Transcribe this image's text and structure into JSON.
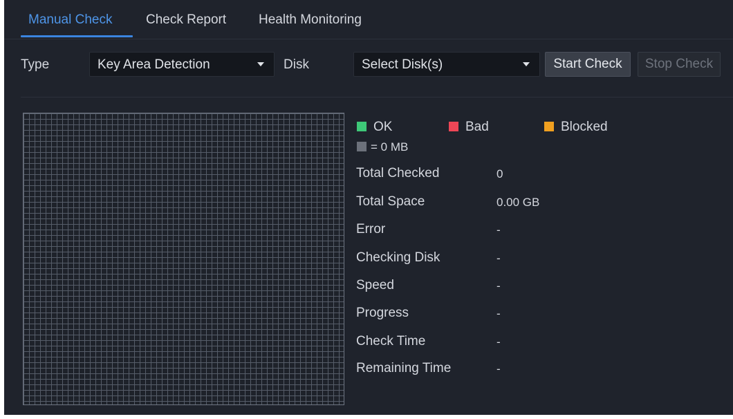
{
  "tabs": [
    {
      "label": "Manual Check",
      "active": true
    },
    {
      "label": "Check Report",
      "active": false
    },
    {
      "label": "Health Monitoring",
      "active": false
    }
  ],
  "toolbar": {
    "type_label": "Type",
    "type_value": "Key Area Detection",
    "disk_label": "Disk",
    "disk_value": "Select Disk(s)",
    "start_label": "Start Check",
    "stop_label": "Stop Check"
  },
  "legend": {
    "ok": {
      "label": "OK",
      "color": "#3ec878"
    },
    "bad": {
      "label": "Bad",
      "color": "#ee4656"
    },
    "blocked": {
      "label": "Blocked",
      "color": "#f0a020"
    },
    "unit": {
      "label": "= 0 MB",
      "color": "#6c717b"
    }
  },
  "info": [
    {
      "label": "Total Checked",
      "value": "0"
    },
    {
      "label": "Total Space",
      "value": "0.00 GB"
    },
    {
      "label": "Error",
      "value": "-"
    },
    {
      "label": "Checking Disk",
      "value": "-"
    },
    {
      "label": "Speed",
      "value": "-"
    },
    {
      "label": "Progress",
      "value": "-"
    },
    {
      "label": "Check Time",
      "value": "-"
    },
    {
      "label": "Remaining Time",
      "value": "-"
    }
  ]
}
